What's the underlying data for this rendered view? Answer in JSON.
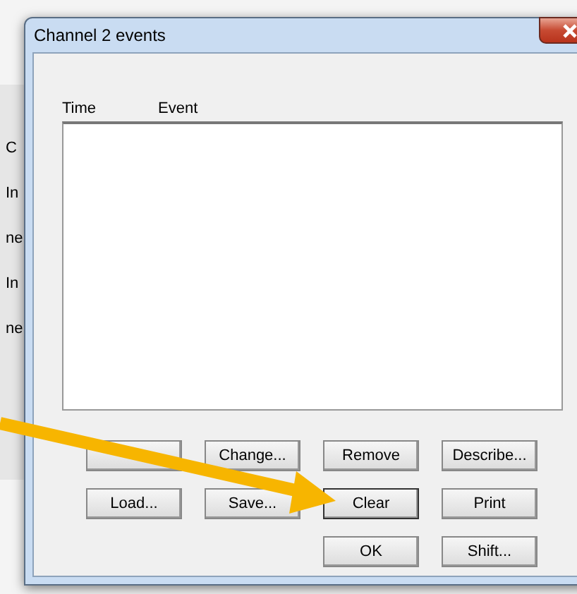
{
  "background_window": {
    "fragments": [
      "C",
      "In",
      "ne",
      "In",
      "ne"
    ]
  },
  "window": {
    "title": "Channel 2 events"
  },
  "list": {
    "columns": [
      "Time",
      "Event"
    ]
  },
  "buttons": [
    {
      "kind": "blank"
    },
    {
      "kind": "text",
      "label": "Change..."
    },
    {
      "kind": "text",
      "label": "Remove"
    },
    {
      "kind": "text",
      "label": "Describe..."
    },
    {
      "kind": "text",
      "label": "Load..."
    },
    {
      "kind": "text",
      "label": "Save..."
    },
    {
      "kind": "text",
      "label": "Clear"
    },
    {
      "kind": "text",
      "label": "Print"
    },
    {
      "kind": "text",
      "label": "OK"
    },
    {
      "kind": "text",
      "label": "Shift..."
    }
  ]
}
